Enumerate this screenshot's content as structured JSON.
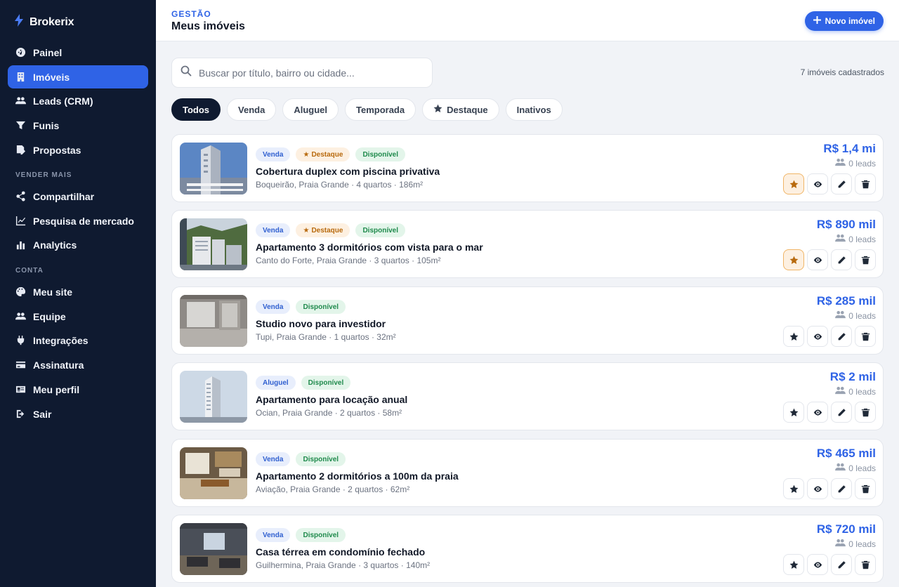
{
  "brand": {
    "name": "Brokerix"
  },
  "sidebar": {
    "items": [
      {
        "label": "Painel",
        "icon": "dashboard-icon",
        "active": false
      },
      {
        "label": "Imóveis",
        "icon": "building-icon",
        "active": true
      },
      {
        "label": "Leads (CRM)",
        "icon": "users-icon",
        "active": false
      },
      {
        "label": "Funis",
        "icon": "funnel-icon",
        "active": false
      },
      {
        "label": "Propostas",
        "icon": "file-edit-icon",
        "active": false
      }
    ],
    "section_sell": "VENDER MAIS",
    "sell_items": [
      {
        "label": "Compartilhar",
        "icon": "share-icon"
      },
      {
        "label": "Pesquisa de mercado",
        "icon": "line-chart-icon"
      },
      {
        "label": "Analytics",
        "icon": "bar-chart-icon"
      }
    ],
    "section_account": "CONTA",
    "account_items": [
      {
        "label": "Meu site",
        "icon": "palette-icon"
      },
      {
        "label": "Equipe",
        "icon": "team-icon"
      },
      {
        "label": "Integrações",
        "icon": "plug-icon"
      },
      {
        "label": "Assinatura",
        "icon": "credit-card-icon"
      },
      {
        "label": "Meu perfil",
        "icon": "id-card-icon"
      },
      {
        "label": "Sair",
        "icon": "logout-icon"
      }
    ]
  },
  "header": {
    "eyebrow": "GESTÃO",
    "title": "Meus imóveis",
    "new_button": "Novo imóvel"
  },
  "search": {
    "placeholder": "Buscar por título, bairro ou cidade...",
    "value": ""
  },
  "count_text": "7 imóveis cadastrados",
  "filters": [
    "Todos",
    "Venda",
    "Aluguel",
    "Temporada",
    "Destaque",
    "Inativos"
  ],
  "active_filter": "Todos",
  "listings": [
    {
      "type": "Venda",
      "featured": true,
      "featured_label": "Destaque",
      "status": "Disponível",
      "title": "Cobertura duplex com piscina privativa",
      "meta": "Boqueirão, Praia Grande · 4 quartos · 186m²",
      "price": "R$ 1,4 mi",
      "leads": "0 leads"
    },
    {
      "type": "Venda",
      "featured": true,
      "featured_label": "Destaque",
      "status": "Disponível",
      "title": "Apartamento 3 dormitórios com vista para o mar",
      "meta": "Canto do Forte, Praia Grande · 3 quartos · 105m²",
      "price": "R$ 890 mil",
      "leads": "0 leads"
    },
    {
      "type": "Venda",
      "featured": false,
      "status": "Disponível",
      "title": "Studio novo para investidor",
      "meta": "Tupi, Praia Grande · 1 quartos · 32m²",
      "price": "R$ 285 mil",
      "leads": "0 leads"
    },
    {
      "type": "Aluguel",
      "featured": false,
      "status": "Disponível",
      "title": "Apartamento para locação anual",
      "meta": "Ocian, Praia Grande · 2 quartos · 58m²",
      "price": "R$ 2 mil",
      "leads": "0 leads"
    },
    {
      "type": "Venda",
      "featured": false,
      "status": "Disponível",
      "title": "Apartamento 2 dormitórios a 100m da praia",
      "meta": "Aviação, Praia Grande · 2 quartos · 62m²",
      "price": "R$ 465 mil",
      "leads": "0 leads"
    },
    {
      "type": "Venda",
      "featured": false,
      "status": "Disponível",
      "title": "Casa térrea em condomínio fechado",
      "meta": "Guilhermina, Praia Grande · 3 quartos · 140m²",
      "price": "R$ 720 mil",
      "leads": "0 leads"
    }
  ],
  "colors": {
    "sidebar_bg": "#0f1a30",
    "accent": "#2f63e6",
    "featured": "#b86a0e",
    "available": "#1f8a4c"
  }
}
